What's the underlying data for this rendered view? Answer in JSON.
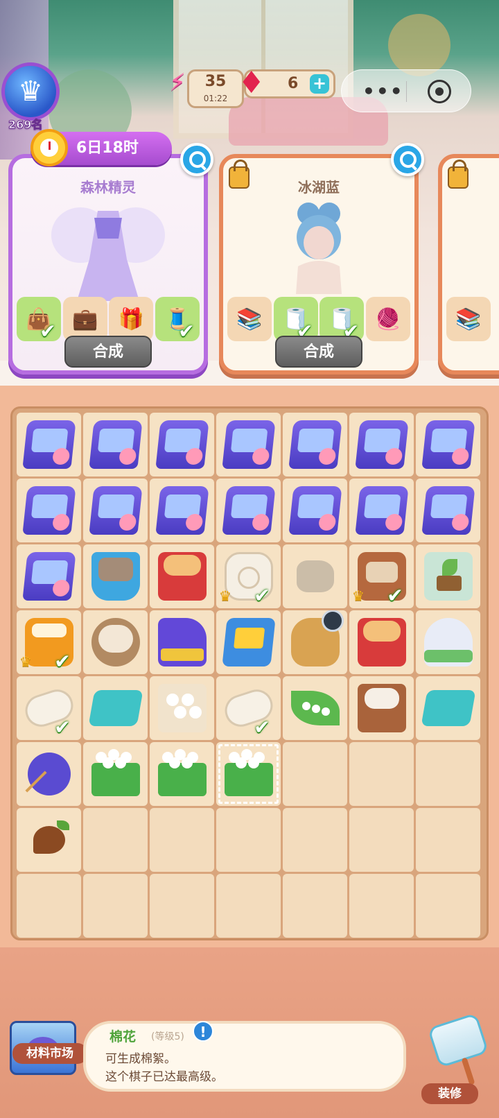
{
  "hud": {
    "rank": "269名",
    "energy": "35",
    "energy_timer": "01:22",
    "gems": "6",
    "gem_add": "+",
    "capsule_more": "•••"
  },
  "orders": [
    {
      "name": "森林精灵",
      "timer": "6日18时",
      "button": "合成",
      "active": true,
      "requirements": [
        {
          "icon": "leather-bag-icon",
          "done": true
        },
        {
          "icon": "leather-bag-icon",
          "done": false
        },
        {
          "icon": "gift-box-icon",
          "done": false
        },
        {
          "icon": "tape-measure-icon",
          "done": true
        }
      ]
    },
    {
      "name": "冰湖蓝",
      "button": "合成",
      "locked": true,
      "requirements": [
        {
          "icon": "fabric-stack-icon",
          "done": false
        },
        {
          "icon": "towel-roll-icon",
          "done": true
        },
        {
          "icon": "towel-roll-icon",
          "done": true
        },
        {
          "icon": "sewing-machine-icon",
          "done": false
        }
      ]
    }
  ],
  "board": {
    "cells": [
      "sewingbox",
      "sewingbox",
      "sewingbox",
      "sewingbox",
      "sewingbox",
      "sewingbox",
      "sewingbox",
      "sewingbox",
      "sewingbox",
      "sewingbox",
      "sewingbox",
      "sewingbox",
      "sewingbox",
      "sewingbox",
      "sewingbox",
      "stonebucket",
      "rollbox",
      "towel",
      "rock",
      "bag",
      "sprout",
      "coffee",
      "woodrolls",
      "machine",
      "goldbox",
      "seedbag",
      "rollbox",
      "silk",
      "roll",
      "teal",
      "cotton",
      "roll",
      "leaf",
      "cottonbox",
      "teal",
      "yarn",
      "planter",
      "planter",
      "planter",
      "",
      "",
      "",
      "seed",
      "",
      "",
      "",
      "",
      "",
      "",
      "",
      "",
      "",
      "",
      "",
      "",
      ""
    ],
    "checks": [
      17,
      19,
      21,
      28,
      31
    ],
    "crowns": [
      17,
      19,
      21
    ],
    "selected": 38
  },
  "bottom": {
    "market_label": "材料市场",
    "decorate_label": "装修",
    "info_icon": "!",
    "item_name": "棉花",
    "item_level": "(等级5)",
    "item_desc_1": "可生成棉絮。",
    "item_desc_2": "这个棋子已达最高级。"
  },
  "colors": {
    "active_card_border": "#b66de0",
    "card_border": "#e7885a",
    "check_green": "#2b8a1b",
    "board_bg": "#d9a57c"
  }
}
